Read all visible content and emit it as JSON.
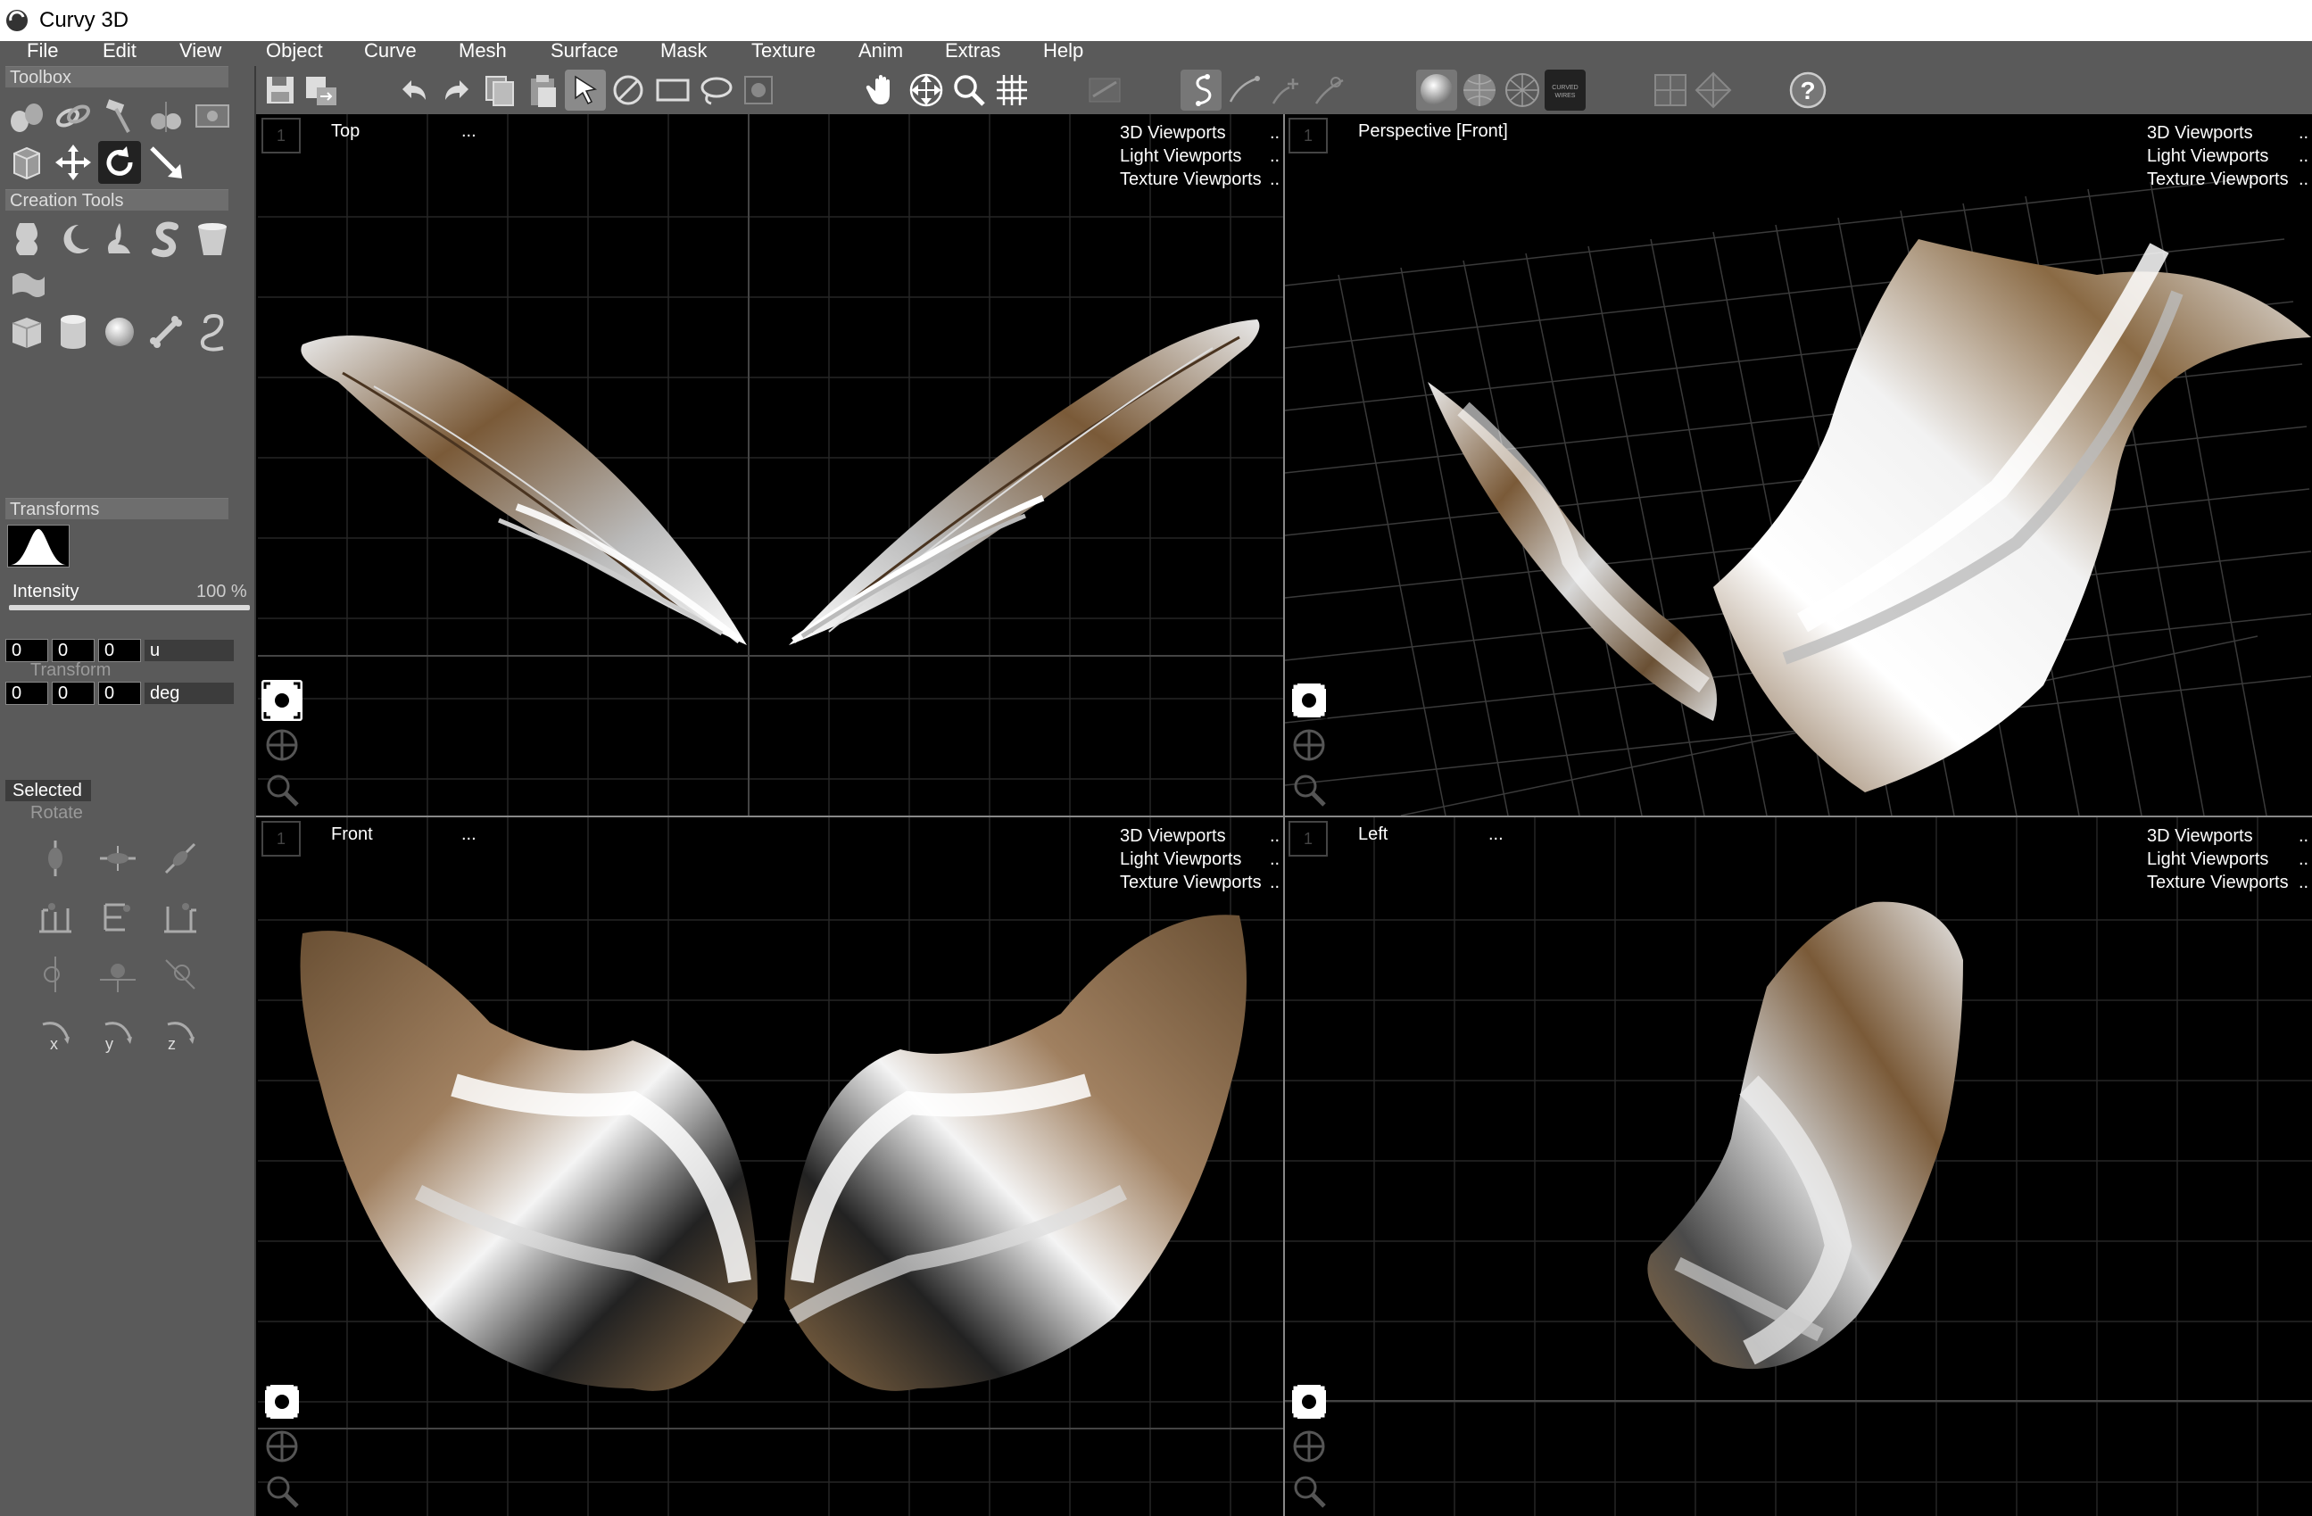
{
  "app": {
    "title": "Curvy 3D",
    "logo_icon": "curvy-logo-icon"
  },
  "menu": [
    "File",
    "Edit",
    "View",
    "Object",
    "Curve",
    "Mesh",
    "Surface",
    "Mask",
    "Texture",
    "Anim",
    "Extras",
    "Help"
  ],
  "toolbar": {
    "icons": [
      "save-icon",
      "save-as-icon",
      "undo-icon",
      "redo-icon",
      "copy-icon",
      "paste-icon",
      "select-arrow-icon",
      "deselect-icon",
      "rect-select-icon",
      "lasso-select-icon",
      "mask-select-icon",
      "pan-hand-icon",
      "move-view-icon",
      "zoom-icon",
      "grid-icon",
      "ruler-icon",
      "curve-tool-icon",
      "curve-edit-icon",
      "curve-add-icon",
      "curve-remove-icon",
      "shaded-sphere-icon",
      "wire-sphere-icon",
      "wireframe-icon",
      "curved-wires-icon",
      "single-view-icon",
      "quad-view-icon",
      "help-icon"
    ],
    "curved_wires_text": "CURVED WIRES"
  },
  "panel": {
    "toolbox_title": "Toolbox",
    "creation_title": "Creation Tools",
    "transforms_title": "Transforms",
    "intensity_label": "Intensity",
    "intensity_value": "100 %",
    "intensity_fraction": 1.0,
    "translate": {
      "x": "0",
      "y": "0",
      "z": "0",
      "unit": "u"
    },
    "transform_label": "Transform",
    "rotate_fields": {
      "x": "0",
      "y": "0",
      "z": "0",
      "unit": "deg"
    },
    "selected_label": "Selected",
    "rotate_label": "Rotate",
    "axis_labels": [
      "x",
      "y",
      "z"
    ]
  },
  "viewports": {
    "top": {
      "name": "Top",
      "dots": "...",
      "num": "1",
      "menu": [
        "3D Viewports",
        "Light Viewports",
        "Texture Viewports"
      ]
    },
    "perspective": {
      "name": "Perspective [Front]",
      "dots": "",
      "num": "1",
      "menu": [
        "3D Viewports",
        "Light Viewports",
        "Texture Viewports"
      ]
    },
    "front": {
      "name": "Front",
      "dots": "...",
      "num": "1",
      "menu": [
        "3D Viewports",
        "Light Viewports",
        "Texture Viewports"
      ]
    },
    "left": {
      "name": "Left",
      "dots": "...",
      "num": "1",
      "menu": [
        "3D Viewports",
        "Light Viewports",
        "Texture Viewports"
      ]
    },
    "menu_overflow": ".."
  },
  "colors": {
    "panel_bg": "#5a5a5a",
    "feather_brown": "#8a6a44",
    "feather_white": "#f2f2f2",
    "grid": "#2c2c2c"
  }
}
